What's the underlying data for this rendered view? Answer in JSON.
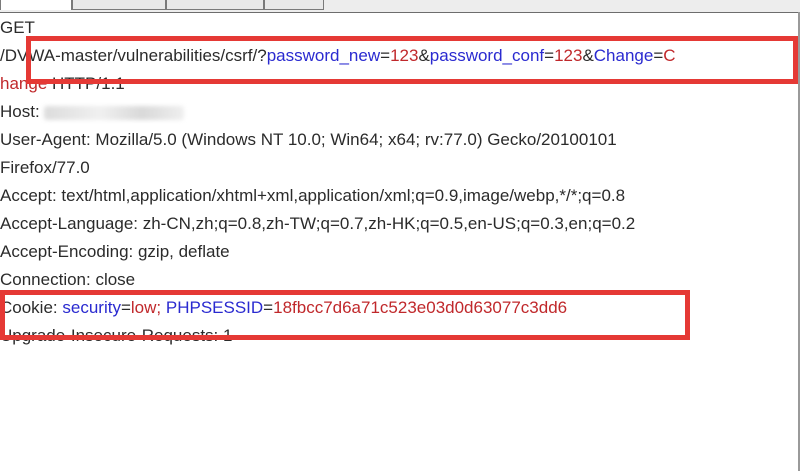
{
  "request": {
    "method": "GET",
    "path_prefix": "/DVWA-master/vulnerabilities/csrf/?",
    "param1_key": "password_new",
    "eq": "=",
    "amp": "&",
    "param1_val": "123",
    "param2_key": "password_conf",
    "param2_val": "123",
    "param3_key": "Change",
    "param3_val_part1": "C",
    "param3_val_part2": "hange",
    "protocol": " HTTP/1.1"
  },
  "headers": {
    "host_label": "Host: ",
    "user_agent_line1": "User-Agent: Mozilla/5.0 (Windows NT 10.0; Win64; x64; rv:77.0) Gecko/20100101",
    "user_agent_line2": "Firefox/77.0",
    "accept": "Accept: text/html,application/xhtml+xml,application/xml;q=0.9,image/webp,*/*;q=0.8",
    "accept_language": "Accept-Language: zh-CN,zh;q=0.8,zh-TW;q=0.7,zh-HK;q=0.5,en-US;q=0.3,en;q=0.2",
    "accept_encoding": "Accept-Encoding: gzip, deflate",
    "connection": "Connection: close",
    "cookie_label": "Cookie: ",
    "cookie_k1": "security",
    "cookie_v1": "low;",
    "cookie_k2": "PHPSESSID",
    "cookie_v2": "18fbcc7d6a71c523e03d0d63077c3dd6",
    "upgrade": "Upgrade-Insecure-Requests: 1"
  },
  "colors": {
    "param_key": "#2a2ad0",
    "param_value": "#c0282b",
    "highlight_border": "#e53935"
  }
}
